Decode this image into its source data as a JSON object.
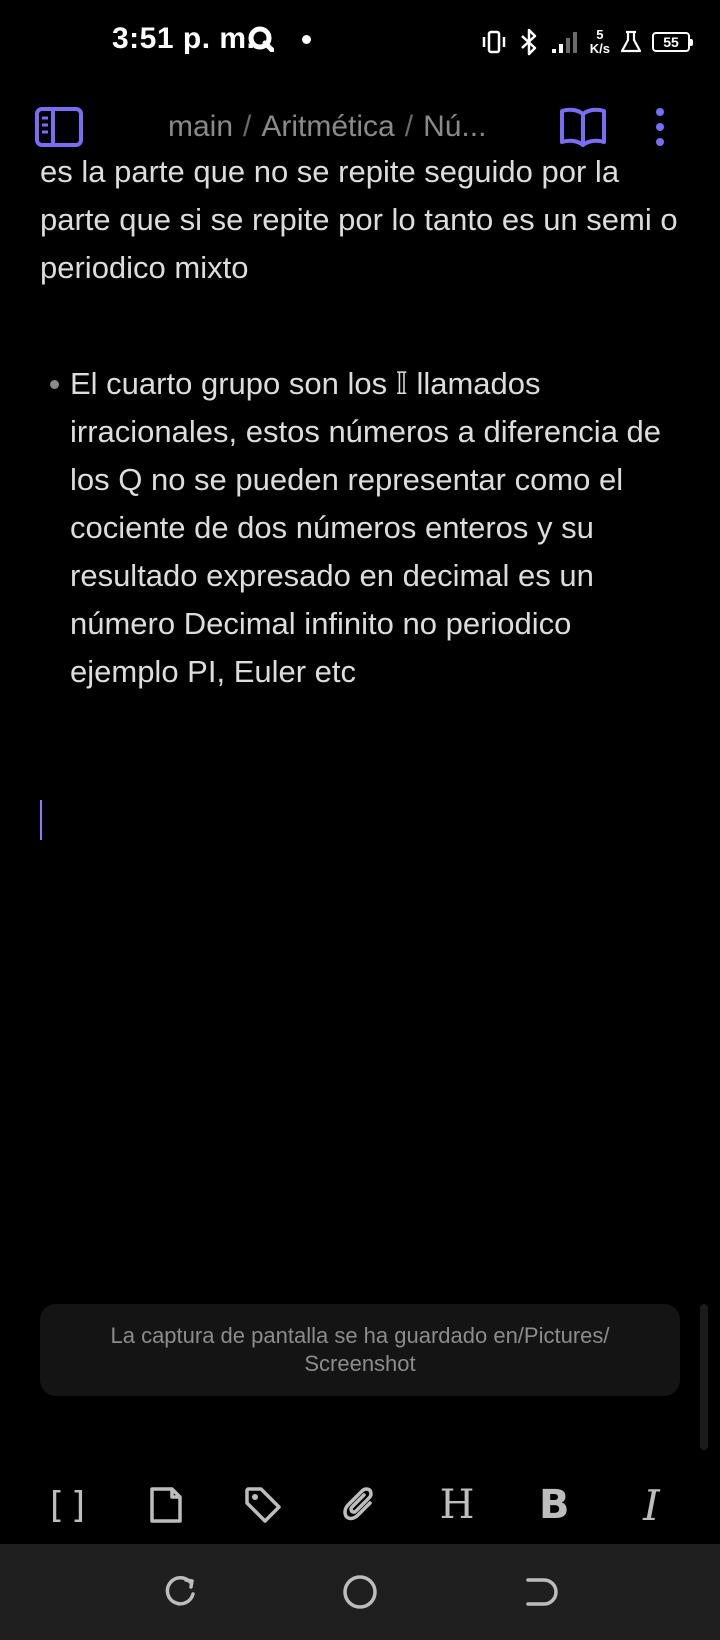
{
  "status_bar": {
    "time": "3:51 p. m.",
    "net_speed_value": "5",
    "net_speed_unit": "K/s",
    "battery": "55"
  },
  "header": {
    "breadcrumb": [
      "main",
      "Aritmética",
      "Nú..."
    ]
  },
  "editor": {
    "paragraph_prev": "es la parte que no se repite seguido por la parte que si se repite por lo tanto es un semi o periodico mixto",
    "bullet_text": "El cuarto grupo son los 𝕀 llamados irracionales, estos números a diferencia de los Q no se pueden representar como el cociente de dos números enteros y su resultado expresado en decimal es un número Decimal infinito no periodico ejemplo PI, Euler etc"
  },
  "toast": {
    "message": "La captura de pantalla se ha guardado en/Pictures/ Screenshot"
  },
  "toolbar": {
    "heading_label": "H",
    "bold_label": "B",
    "italic_label": "I",
    "link_label": "[]"
  },
  "colors": {
    "accent": "#7b6cf6",
    "background": "#000000",
    "text": "#dcddde",
    "muted": "#8a8a8a"
  },
  "icons": {
    "sidebar_toggle": "sidebar-icon",
    "reading_mode": "book-open-icon",
    "more": "more-vertical-icon",
    "file": "file-icon",
    "tag": "tag-icon",
    "attachment": "paperclip-icon",
    "nav_recents": "recents-icon",
    "nav_home": "home-icon",
    "nav_back": "back-icon"
  }
}
